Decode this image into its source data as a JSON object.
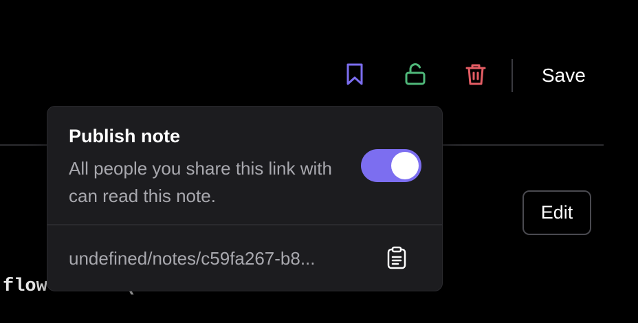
{
  "toolbar": {
    "bookmark_icon": "bookmark-icon",
    "unlock_icon": "unlock-icon",
    "trash_icon": "trash-icon",
    "save_label": "Save"
  },
  "colors": {
    "bookmark": "#7c6ef0",
    "unlock": "#4fb87a",
    "trash": "#e35d64",
    "toggle_on": "#7c6ef0"
  },
  "content": {
    "edit_label": "Edit",
    "code_snippet": "flow-test` (from"
  },
  "publish_popover": {
    "title": "Publish note",
    "description": "All people you share this link with can read this note.",
    "published": true,
    "link": "undefined/notes/c59fa267-b8...",
    "copy_icon": "clipboard-icon"
  }
}
